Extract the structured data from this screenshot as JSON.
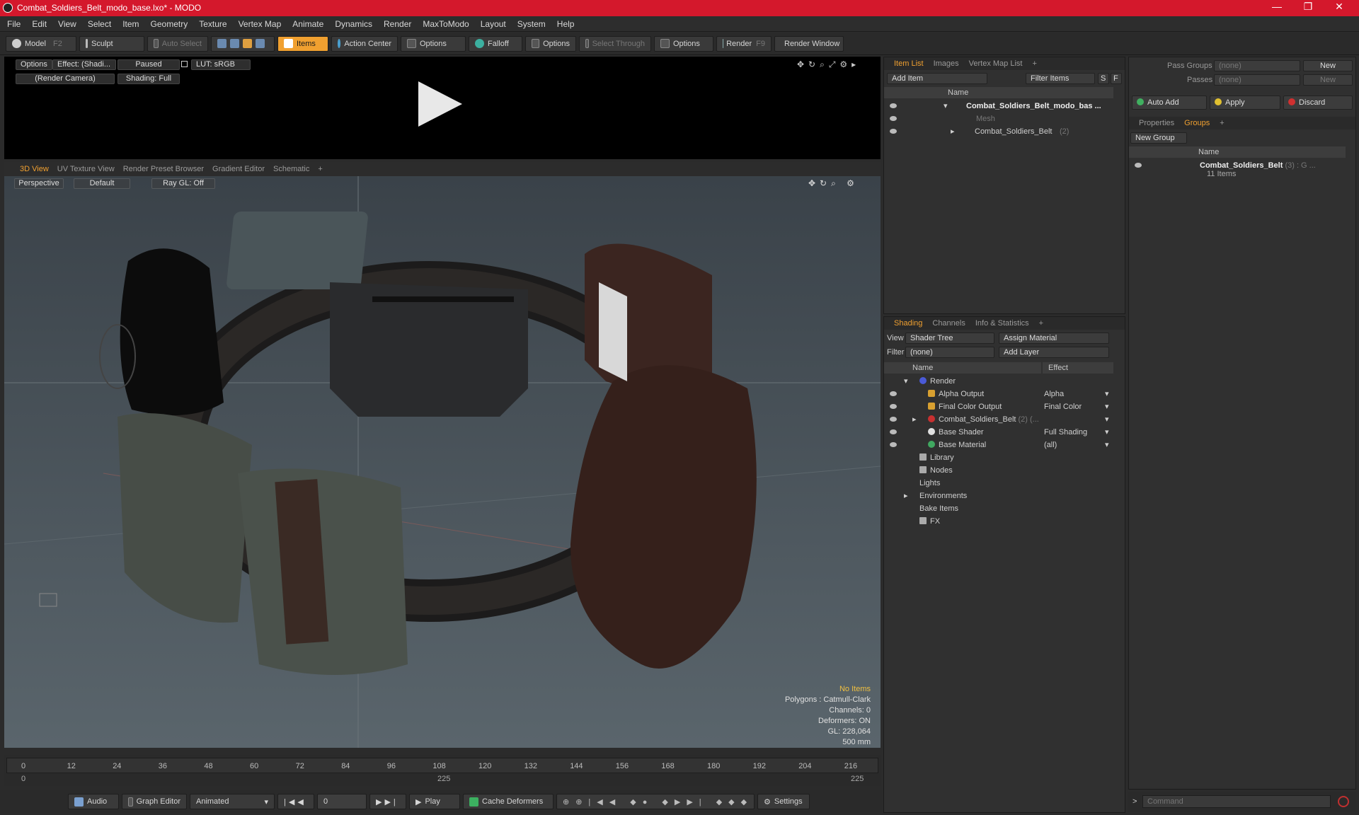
{
  "window": {
    "title": "Combat_Soldiers_Belt_modo_base.lxo* - MODO",
    "minimize": "—",
    "restore": "❐",
    "close": "✕"
  },
  "menu": [
    "File",
    "Edit",
    "View",
    "Select",
    "Item",
    "Geometry",
    "Texture",
    "Vertex Map",
    "Animate",
    "Dynamics",
    "Render",
    "MaxToModo",
    "Layout",
    "System",
    "Help"
  ],
  "toolbar": {
    "model": "Model",
    "model_key": "F2",
    "sculpt": "Sculpt",
    "auto_select": "Auto Select",
    "items": "Items",
    "action_center": "Action Center",
    "options1": "Options",
    "falloff": "Falloff",
    "options2": "Options",
    "select_through": "Select Through",
    "options3": "Options",
    "render": "Render",
    "render_key": "F9",
    "render_window": "Render Window"
  },
  "preview": {
    "options": "Options",
    "effect": "Effect: (Shadi...",
    "paused": "Paused",
    "lut": "LUT: sRGB",
    "camera": "(Render Camera)",
    "shading": "Shading: Full"
  },
  "viewport_tabs": [
    "3D View",
    "UV Texture View",
    "Render Preset Browser",
    "Gradient Editor",
    "Schematic",
    "+"
  ],
  "viewport": {
    "perspective": "Perspective",
    "default": "Default",
    "raygl": "Ray GL: Off"
  },
  "stats": {
    "items": "No Items",
    "polygons": "Polygons : Catmull-Clark",
    "channels": "Channels: 0",
    "deformers": "Deformers: ON",
    "gl": "GL: 228,064",
    "scale": "500 mm"
  },
  "timeline": {
    "ticks": [
      "0",
      "12",
      "24",
      "36",
      "48",
      "60",
      "72",
      "84",
      "96",
      "108",
      "120",
      "132",
      "144",
      "156",
      "168",
      "180",
      "192",
      "204",
      "216"
    ],
    "start": "0",
    "mid": "225",
    "end": "225"
  },
  "bottombar": {
    "audio": "Audio",
    "graph_editor": "Graph Editor",
    "animated": "Animated",
    "frame": "0",
    "play": "Play",
    "cache": "Cache Deformers",
    "settings": "Settings"
  },
  "itemlist": {
    "tabs": [
      "Item List",
      "Images",
      "Vertex Map List",
      "+"
    ],
    "add_item": "Add Item",
    "filter_items": "Filter Items",
    "s": "S",
    "f": "F",
    "col_name": "Name",
    "rows": [
      "Combat_Soldiers_Belt_modo_bas ...",
      "Mesh",
      "Combat_Soldiers_Belt"
    ],
    "row3_count": "(2)"
  },
  "shading": {
    "tabs": [
      "Shading",
      "Channels",
      "Info & Statistics",
      "+"
    ],
    "view_label": "View",
    "view_value": "Shader Tree",
    "assign": "Assign Material",
    "filter_label": "Filter",
    "filter_value": "(none)",
    "add_layer": "Add Layer",
    "col_name": "Name",
    "col_effect": "Effect",
    "rows": [
      {
        "name": "Render",
        "effect": ""
      },
      {
        "name": "Alpha Output",
        "effect": "Alpha"
      },
      {
        "name": "Final Color Output",
        "effect": "Final Color"
      },
      {
        "name": "Combat_Soldiers_Belt",
        "effect": ""
      },
      {
        "name": "Base Shader",
        "effect": "Full Shading"
      },
      {
        "name": "Base Material",
        "effect": "(all)"
      },
      {
        "name": "Library",
        "effect": ""
      },
      {
        "name": "Nodes",
        "effect": ""
      },
      {
        "name": "Lights",
        "effect": ""
      },
      {
        "name": "Environments",
        "effect": ""
      },
      {
        "name": "Bake Items",
        "effect": ""
      },
      {
        "name": "FX",
        "effect": ""
      }
    ],
    "belt_suffix": "(2) (..."
  },
  "groups_panel": {
    "pass_groups": "Pass Groups",
    "pass_value": "(none)",
    "new": "New",
    "passes": "Passes",
    "passes_value": "(none)",
    "new2": "New",
    "auto_add": "Auto Add",
    "apply": "Apply",
    "discard": "Discard",
    "tabs": [
      "Properties",
      "Groups",
      "+"
    ],
    "new_group": "New Group",
    "col_name": "Name",
    "group_name": "Combat_Soldiers_Belt",
    "group_suffix": "(3) : G ...",
    "group_items": "11 Items"
  },
  "command": {
    "placeholder": "Command"
  }
}
